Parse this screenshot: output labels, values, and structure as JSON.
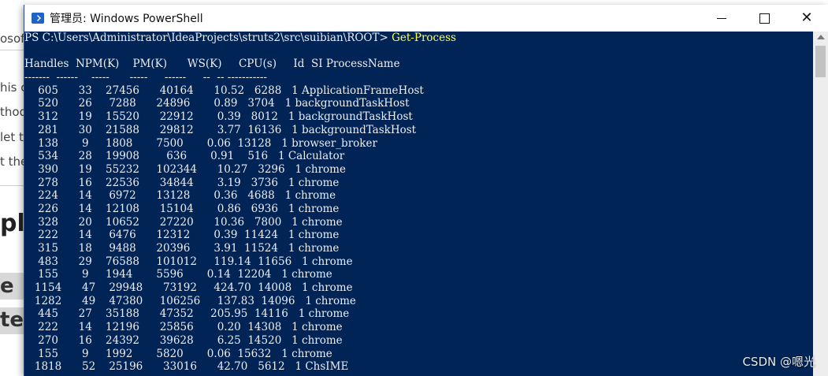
{
  "background_doc": {
    "fragments": [
      "osof",
      "his c",
      "thod",
      "let t",
      "t the"
    ],
    "heading": "ple",
    "band1": "e",
    "band2": "ter"
  },
  "window": {
    "title": "管理员: Windows PowerShell",
    "controls": {
      "minimize": "minimize",
      "maximize": "maximize",
      "close": "✕"
    }
  },
  "console": {
    "prompt": "PS C:\\Users\\Administrator\\IdeaProjects\\struts2\\src\\suibian\\ROOT> ",
    "command": "Get-Process",
    "header": "Handles  NPM(K)    PM(K)      WS(K)     CPU(s)     Id  SI ProcessName",
    "separator": "-------  ------    -----      -----     ------     --  -- -----------",
    "rows": [
      "    605      33    27456      40164      10.52   6288   1 ApplicationFrameHost",
      "    520      26     7288      24896       0.89   3704   1 backgroundTaskHost",
      "    312      19    15520      22912       0.39   8012   1 backgroundTaskHost",
      "    281      30    21588      29812       3.77  16136   1 backgroundTaskHost",
      "    138       9     1808       7500       0.06  13128   1 browser_broker",
      "    534      28    19908        636       0.91    516   1 Calculator",
      "    390      19    55232     102344      10.27   3296   1 chrome",
      "    278      16    22536      34844       3.19   3736   1 chrome",
      "    224      14     6972      13128       0.36   4688   1 chrome",
      "    226      14    12108      15104       0.86   6936   1 chrome",
      "    328      20    10652      27220      10.36   7800   1 chrome",
      "    222      14     6476      12312       0.39  11424   1 chrome",
      "    315      18     9488      20396       3.91  11524   1 chrome",
      "    483      29    76588     101012     119.14  11656   1 chrome",
      "    155       9     1944       5596       0.14  12204   1 chrome",
      "   1154      47    29948      73192     424.70  14008   1 chrome",
      "   1282      49    47380     106256     137.83  14096   1 chrome",
      "    445      27    35188      47352     205.95  14116   1 chrome",
      "    222      14    12196      25856       0.20  14308   1 chrome",
      "    270      16    24392      39628       6.25  14520   1 chrome",
      "    155       9     1992       5820       0.06  15632   1 chrome",
      "   1818      52    25196      33016      42.70   5612   1 ChsIME"
    ]
  },
  "watermark": "CSDN @嗯光",
  "colors": {
    "console_bg": "#012456",
    "console_fg": "#eeedf0",
    "command": "#ffff55"
  }
}
